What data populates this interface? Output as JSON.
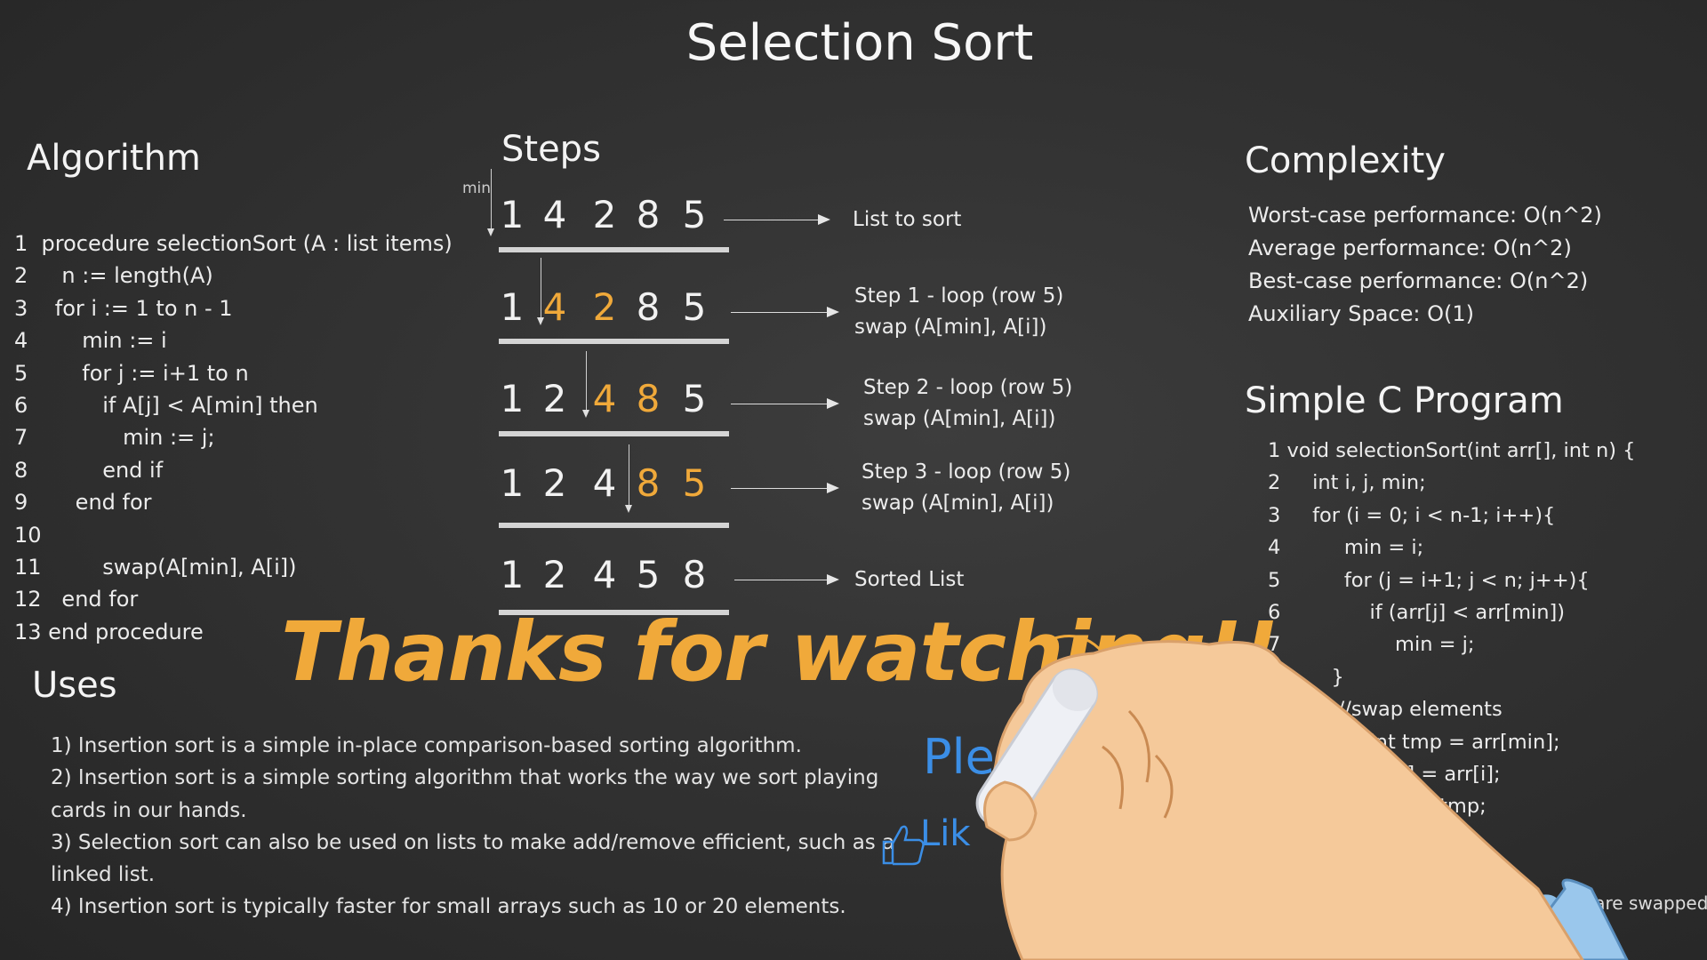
{
  "title": "Selection Sort",
  "algorithm": {
    "heading": "Algorithm",
    "lines": [
      "1  procedure selectionSort (A : list items)",
      "2     n := length(A)",
      "3    for i := 1 to n - 1",
      "4        min := i",
      "5        for j := i+1 to n",
      "6           if A[j] < A[min] then",
      "7              min := j;",
      "8           end if",
      "9       end for",
      "10",
      "11         swap(A[min], A[i])",
      "12   end for",
      "13 end procedure"
    ]
  },
  "uses": {
    "heading": "Uses",
    "lines": [
      "1) Insertion sort is a simple in-place comparison-based sorting algorithm.",
      "2) Insertion sort is a simple sorting algorithm that works the way we sort playing",
      "cards in our hands.",
      "3) Selection sort can also be used on lists to make add/remove efficient, such as a",
      "linked list.",
      "4) Insertion sort is typically faster for small arrays such as 10 or 20 elements."
    ]
  },
  "steps": {
    "heading": "Steps",
    "min_label": "min",
    "highlight_color": "#f0a93a",
    "rows": [
      {
        "digits": [
          "1",
          "4",
          "2",
          "8",
          "5"
        ],
        "highlight": [],
        "label": [
          "List to sort"
        ]
      },
      {
        "digits": [
          "1",
          "4",
          "2",
          "8",
          "5"
        ],
        "highlight": [
          1,
          2
        ],
        "label": [
          "Step 1 - loop (row 5)",
          "swap (A[min], A[i])"
        ]
      },
      {
        "digits": [
          "1",
          "2",
          "4",
          "8",
          "5"
        ],
        "highlight": [
          2,
          3
        ],
        "label": [
          "Step 2 - loop (row 5)",
          "swap (A[min], A[i])"
        ]
      },
      {
        "digits": [
          "1",
          "2",
          "4",
          "8",
          "5"
        ],
        "highlight": [
          3,
          4
        ],
        "label": [
          "Step 3 - loop (row 5)",
          "swap (A[min], A[i])"
        ]
      },
      {
        "digits": [
          "1",
          "2",
          "4",
          "5",
          "8"
        ],
        "highlight": [],
        "label": [
          "Sorted List"
        ]
      }
    ]
  },
  "complexity": {
    "heading": "Complexity",
    "lines": [
      "Worst-case performance: O(n^2)",
      "Average performance: O(n^2)",
      "Best-case performance: O(n^2)",
      "Auxiliary Space: O(1)"
    ]
  },
  "c_program": {
    "heading": "Simple C Program",
    "lines": [
      "1 void selectionSort(int arr[], int n) {",
      "2     int i, j, min;",
      "3     for (i = 0; i < n-1; i++){",
      "4          min = i;",
      "5          for (j = i+1; j < n; j++){",
      "6              if (arr[j] < arr[min])",
      "7                  min = j;",
      "          }",
      "           //swap elements",
      "                int tmp = arr[min];",
      "                   in] = arr[i];",
      "                           tmp;"
    ]
  },
  "overlay": {
    "thanks": "Thanks for watching!!",
    "please": "Ple",
    "like": "Lik",
    "swapped_fragment": "ms are swapped",
    "thanks_color": "#f0a93a",
    "blue_color": "#3b8ee6",
    "hand_icon": "hand-holding-chalk",
    "like_icon": "thumbs-up"
  }
}
